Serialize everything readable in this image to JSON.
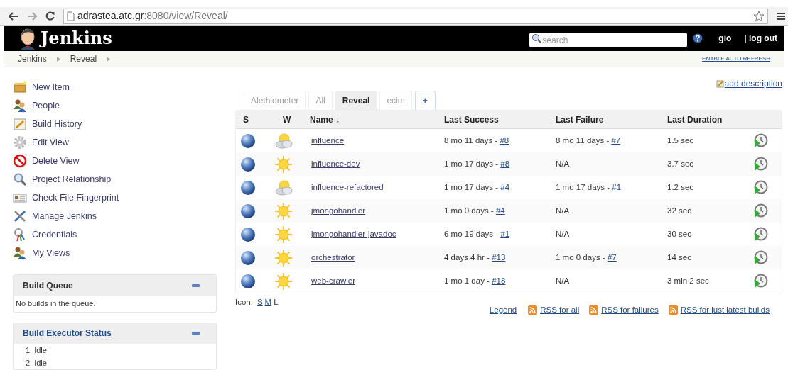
{
  "browser": {
    "url_host": "adrastea.atc.gr",
    "url_path": ":8080/view/Reveal/"
  },
  "header": {
    "logo": "Jenkins",
    "search_placeholder": "search",
    "user": "gio",
    "logout": "| log out"
  },
  "breadcrumbs": [
    "Jenkins",
    "Reveal"
  ],
  "auto_refresh": "ENABLE AUTO REFRESH",
  "sidebar": {
    "items": [
      "New Item",
      "People",
      "Build History",
      "Edit View",
      "Delete View",
      "Project Relationship",
      "Check File Fingerprint",
      "Manage Jenkins",
      "Credentials",
      "My Views"
    ]
  },
  "build_queue": {
    "title": "Build Queue",
    "text": "No builds in the queue."
  },
  "executor_status": {
    "title": "Build Executor Status",
    "executors": [
      {
        "number": "1",
        "state": "Idle"
      },
      {
        "number": "2",
        "state": "Idle"
      }
    ]
  },
  "add_description": "add description",
  "tabs": [
    {
      "label": "Alethiometer",
      "selected": false
    },
    {
      "label": "All",
      "selected": false
    },
    {
      "label": "Reveal",
      "selected": true
    },
    {
      "label": "ecim",
      "selected": false
    },
    {
      "label": "+",
      "selected": false
    }
  ],
  "table": {
    "columns": [
      "S",
      "W",
      "Name ↓",
      "Last Success",
      "Last Failure",
      "Last Duration"
    ],
    "rows": [
      {
        "kind": "cloudy",
        "name": "influence",
        "last_success": {
          "text": "8 mo 11 days - ",
          "build": "#8"
        },
        "last_failure": {
          "text": "8 mo 11 days - ",
          "build": "#7"
        },
        "duration": "1.5 sec"
      },
      {
        "kind": "sunny",
        "name": "influence-dev",
        "last_success": {
          "text": "1 mo 17 days - ",
          "build": "#8"
        },
        "last_failure": {
          "text": "N/A"
        },
        "duration": "3.7 sec"
      },
      {
        "kind": "cloudy",
        "name": "influence-refactored",
        "last_success": {
          "text": "1 mo 17 days - ",
          "build": "#4"
        },
        "last_failure": {
          "text": "1 mo 17 days - ",
          "build": "#1"
        },
        "duration": "1.2 sec"
      },
      {
        "kind": "sunny",
        "name": "jmongohandler",
        "last_success": {
          "text": "1 mo 0 days - ",
          "build": "#4"
        },
        "last_failure": {
          "text": "N/A"
        },
        "duration": "32 sec"
      },
      {
        "kind": "sunny",
        "name": "jmongohandler-javadoc",
        "last_success": {
          "text": "6 mo 19 days - ",
          "build": "#1"
        },
        "last_failure": {
          "text": "N/A"
        },
        "duration": "30 sec"
      },
      {
        "kind": "sunny",
        "name": "orchestrator",
        "last_success": {
          "text": "4 days 4 hr - ",
          "build": "#13"
        },
        "last_failure": {
          "text": "1 mo 0 days - ",
          "build": "#7"
        },
        "duration": "14 sec"
      },
      {
        "kind": "sunny",
        "name": "web-crawler",
        "last_success": {
          "text": "1 mo 1 day - ",
          "build": "#18"
        },
        "last_failure": {
          "text": "N/A"
        },
        "duration": "3 min 2 sec"
      }
    ]
  },
  "icon_sizes": {
    "label": "Icon:",
    "sizes": [
      {
        "label": "S",
        "selected": false
      },
      {
        "label": "M",
        "selected": false
      },
      {
        "label": "L",
        "selected": true
      }
    ]
  },
  "feeds": {
    "legend": "Legend",
    "rss": [
      "RSS for all",
      "RSS for failures",
      "RSS for just latest builds"
    ]
  }
}
